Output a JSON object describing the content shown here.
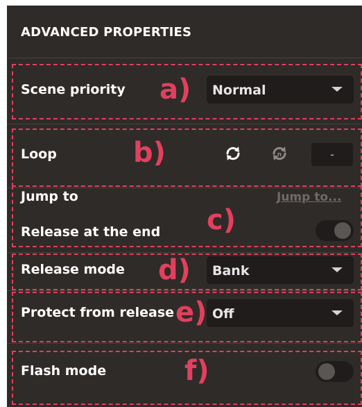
{
  "header": {
    "title": "ADVANCED PROPERTIES"
  },
  "sections": {
    "scene_priority": {
      "label": "Scene priority",
      "annotation": "a)",
      "value": "Normal"
    },
    "loop": {
      "label": "Loop",
      "annotation": "b)",
      "input_value": "-"
    },
    "jump_to": {
      "label": "Jump to",
      "link": "Jump to..."
    },
    "release_at_end": {
      "label": "Release at the end",
      "annotation": "c)",
      "enabled": false
    },
    "release_mode": {
      "label": "Release mode",
      "annotation": "d)",
      "value": "Bank"
    },
    "protect_from_release": {
      "label": "Protect from release",
      "annotation": "e)",
      "value": "Off"
    },
    "flash_mode": {
      "label": "Flash mode",
      "annotation": "f)",
      "enabled": false
    }
  },
  "icons": {
    "loop_active": "loop-icon",
    "loop_disabled": "loop-count-icon"
  },
  "colors": {
    "panel_background": "#2f2b29",
    "annotation": "#e2405e",
    "control_background": "#1f1c1b",
    "text": "#ffffff"
  }
}
